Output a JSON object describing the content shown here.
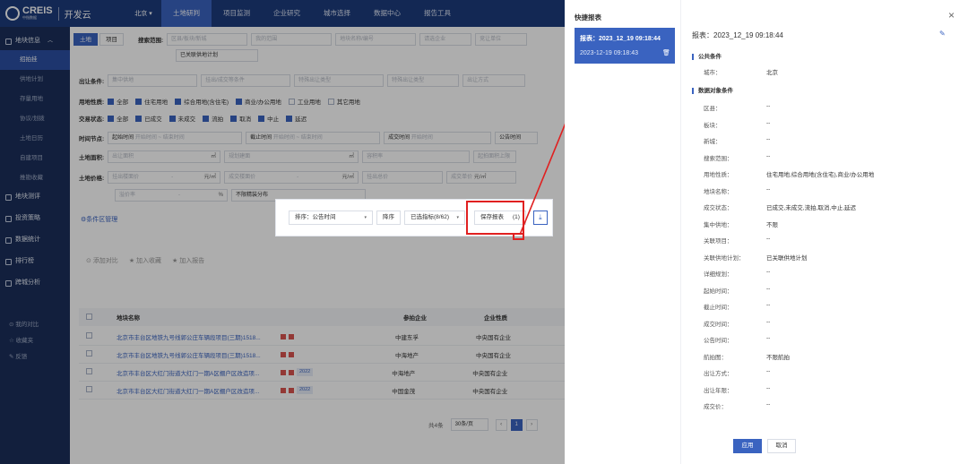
{
  "header": {
    "brand": "CREIS",
    "brand_sub": "中指数据",
    "app_name": "开发云",
    "city": "北京 ▾",
    "nav": [
      "土地研判",
      "项目监测",
      "企业研究",
      "城市选择",
      "数据中心",
      "报告工具"
    ]
  },
  "sidebar": {
    "group1": "地块信息",
    "sub_items": [
      "招拍挂",
      "供地计划",
      "存量用地",
      "协议/划拨",
      "土地日历",
      "自建项目",
      "推勘收藏"
    ],
    "groups": [
      "地块测评",
      "投资策略",
      "数据统计",
      "排行榜",
      "跨城分析"
    ],
    "bottom": [
      "我的对比",
      "收藏夹",
      "反馈"
    ]
  },
  "filters": {
    "tab_land": "土地",
    "tab_project": "项目",
    "search_range_label": "搜索范围:",
    "sel1": "区县/板块/新城",
    "sel2": "我的范围",
    "sel3": "地块名称/编号",
    "sel4": "请选企业",
    "sel5": "竞让单位",
    "supply_plan": "已关联供地计划",
    "transfer_cond_label": "出让条件:",
    "tc1": "集中供地",
    "tc2": "挂出/成交等条件",
    "tc3": "特殊出让类型",
    "tc4": "特殊出让类型",
    "tc5": "出让方式",
    "use_label": "用地性质:",
    "use_items": [
      "全部",
      "住宅用地",
      "综合用地(含住宅)",
      "商业/办公用地",
      "工业用地",
      "其它用地"
    ],
    "status_label": "交易状态:",
    "status_items": [
      "全部",
      "已成交",
      "未成交",
      "流拍",
      "取消",
      "中止",
      "延迟"
    ],
    "time_label": "时间节点:",
    "time_items": [
      "起始时间",
      "开始时间",
      "~",
      "结束时间",
      "截止时间",
      "开始时间",
      "~",
      "结束时间",
      "成交时间",
      "开始时间",
      "公告时间"
    ],
    "area_label": "土地面积:",
    "area_ph": "出让面积",
    "area_unit": "㎡",
    "build_ph": "规划建面",
    "price_label": "土地价格:",
    "price_ph1": "挂出楼面价",
    "price_unit1": "元/㎡",
    "price_ph2": "成交楼面价",
    "price_unit2": "元/㎡",
    "price_ph3": "挂出总价",
    "price_ph4": "成交总价",
    "premium_ph": "溢价率",
    "premium_unit": "%",
    "fine_decor": "不限精装分布",
    "condition_mgr": "条件区管理",
    "extra1": "起拍面积上限",
    "extra2": "容积率",
    "extra3": "成交单价",
    "extra_unit": "元/㎡",
    "dash": "-"
  },
  "actions": {
    "add_compare": "添加对比",
    "add_fav": "加入收藏",
    "add_report": "加入报告"
  },
  "popup": {
    "sort": "排序：公告时间",
    "sort_btn": "降序",
    "selected_cols": "已选指标(8/62)",
    "save_report": "保存报表",
    "count": "(1)",
    "download_icon": "⤓"
  },
  "table": {
    "headers": [
      "地块名称",
      "参拍企业",
      "企业性质"
    ],
    "rows": [
      {
        "name": "北京市丰台区地铁九号线郭公庄车辆段项目(三期)1518...",
        "tag": "",
        "company": "中建东孚",
        "type": "中央国有企业"
      },
      {
        "name": "北京市丰台区地铁九号线郭公庄车辆段项目(三期)1518...",
        "tag": "",
        "company": "中海地产",
        "type": "中央国有企业"
      },
      {
        "name": "北京市丰台区大红门街道大红门一期A区棚户区改造项...",
        "tag": "2022",
        "company": "中海地产",
        "type": "中央国有企业"
      },
      {
        "name": "北京市丰台区大红门街道大红门一期A区棚户区改造项...",
        "tag": "2022",
        "company": "中国金茂",
        "type": "中央国有企业"
      }
    ]
  },
  "pager": {
    "total": "共4条",
    "per_page": "30条/页",
    "page": "1",
    "prev": "‹",
    "next": "›"
  },
  "drawer": {
    "title": "快捷报表",
    "list_title": "报表：2023_12_19 09:18:44",
    "list_sub": "2023-12-19 09:18:43",
    "report_name": "报表：2023_12_19 09:18:44",
    "common_title": "公共条件",
    "city_k": "城市：",
    "city_v": "北京",
    "data_title": "数据对象条件",
    "fields": [
      {
        "k": "区县：",
        "v": "--"
      },
      {
        "k": "板块：",
        "v": "--"
      },
      {
        "k": "新城：",
        "v": "--"
      },
      {
        "k": "搜索范围：",
        "v": "--"
      },
      {
        "k": "用地性质：",
        "v": "住宅用地,综合用地(含住宅),商业/办公用地"
      },
      {
        "k": "地块名称：",
        "v": "--"
      },
      {
        "k": "成交状态：",
        "v": "已成交,未成交,流拍,取消,中止,延迟"
      },
      {
        "k": "集中供地：",
        "v": "不限"
      },
      {
        "k": "关联项目：",
        "v": "--"
      },
      {
        "k": "关联供地计划：",
        "v": "已关联供地计划"
      },
      {
        "k": "详细规划：",
        "v": "--"
      },
      {
        "k": "起始时间：",
        "v": "--"
      },
      {
        "k": "截止时间：",
        "v": "--"
      },
      {
        "k": "成交时间：",
        "v": "--"
      },
      {
        "k": "公告时间：",
        "v": "--"
      },
      {
        "k": "航拍图：",
        "v": "不限航拍"
      },
      {
        "k": "出让方式：",
        "v": "--"
      },
      {
        "k": "出让年限：",
        "v": "--"
      },
      {
        "k": "成交价：",
        "v": "--"
      }
    ],
    "apply": "应用",
    "cancel": "取消",
    "close": "×",
    "edit": "✎",
    "trash": "🗑"
  },
  "colors": {
    "primary": "#3a63c0",
    "topbar": "#1d3b7c",
    "sidebar": "#1b2f5b",
    "highlight": "#e02020"
  }
}
